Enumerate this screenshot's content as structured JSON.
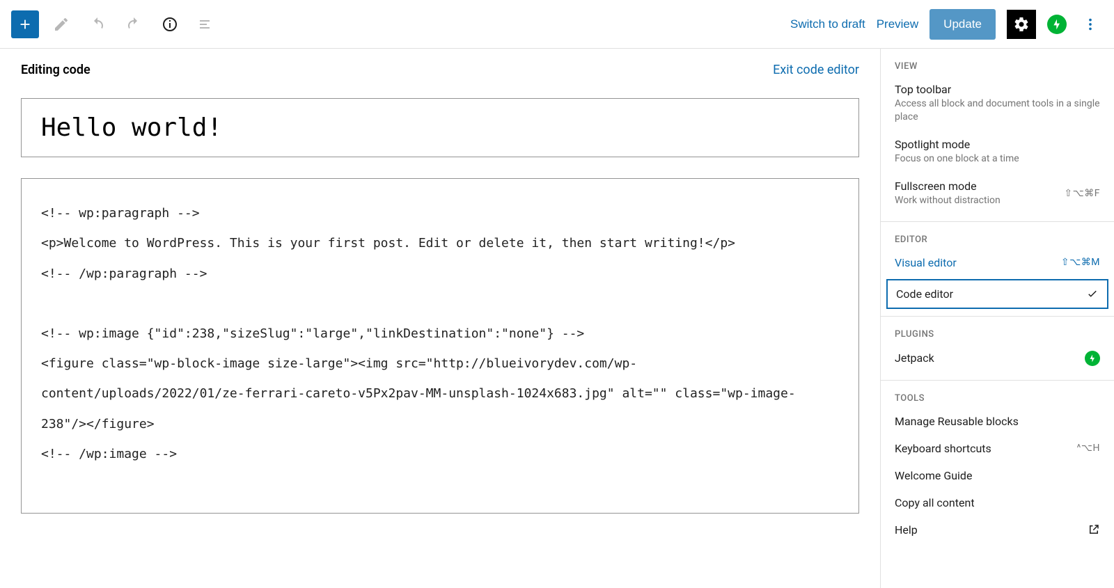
{
  "toolbar": {
    "switch_to_draft": "Switch to draft",
    "preview": "Preview",
    "update": "Update"
  },
  "editor": {
    "heading": "Editing code",
    "exit_label": "Exit code editor",
    "title_value": "Hello world!",
    "code_value": "<!-- wp:paragraph -->\n<p>Welcome to WordPress. This is your first post. Edit or delete it, then start writing!</p>\n<!-- /wp:paragraph -->\n\n<!-- wp:image {\"id\":238,\"sizeSlug\":\"large\",\"linkDestination\":\"none\"} -->\n<figure class=\"wp-block-image size-large\"><img src=\"http://blueivorydev.com/wp-content/uploads/2022/01/ze-ferrari-careto-v5Px2pav-MM-unsplash-1024x683.jpg\" alt=\"\" class=\"wp-image-238\"/></figure>\n<!-- /wp:image -->"
  },
  "panel": {
    "sections": {
      "view": "VIEW",
      "editor": "EDITOR",
      "plugins": "PLUGINS",
      "tools": "TOOLS"
    },
    "view": {
      "top_toolbar": {
        "title": "Top toolbar",
        "desc": "Access all block and document tools in a single place"
      },
      "spotlight": {
        "title": "Spotlight mode",
        "desc": "Focus on one block at a time"
      },
      "fullscreen": {
        "title": "Fullscreen mode",
        "desc": "Work without distraction",
        "shortcut": "⇧⌥⌘F"
      }
    },
    "editor_section": {
      "visual": {
        "title": "Visual editor",
        "shortcut": "⇧⌥⌘M"
      },
      "code": {
        "title": "Code editor"
      }
    },
    "plugins": {
      "jetpack": "Jetpack"
    },
    "tools": {
      "manage_blocks": "Manage Reusable blocks",
      "keyboard_shortcuts": {
        "title": "Keyboard shortcuts",
        "shortcut": "^⌥H"
      },
      "welcome_guide": "Welcome Guide",
      "copy_all": "Copy all content",
      "help": "Help"
    }
  }
}
